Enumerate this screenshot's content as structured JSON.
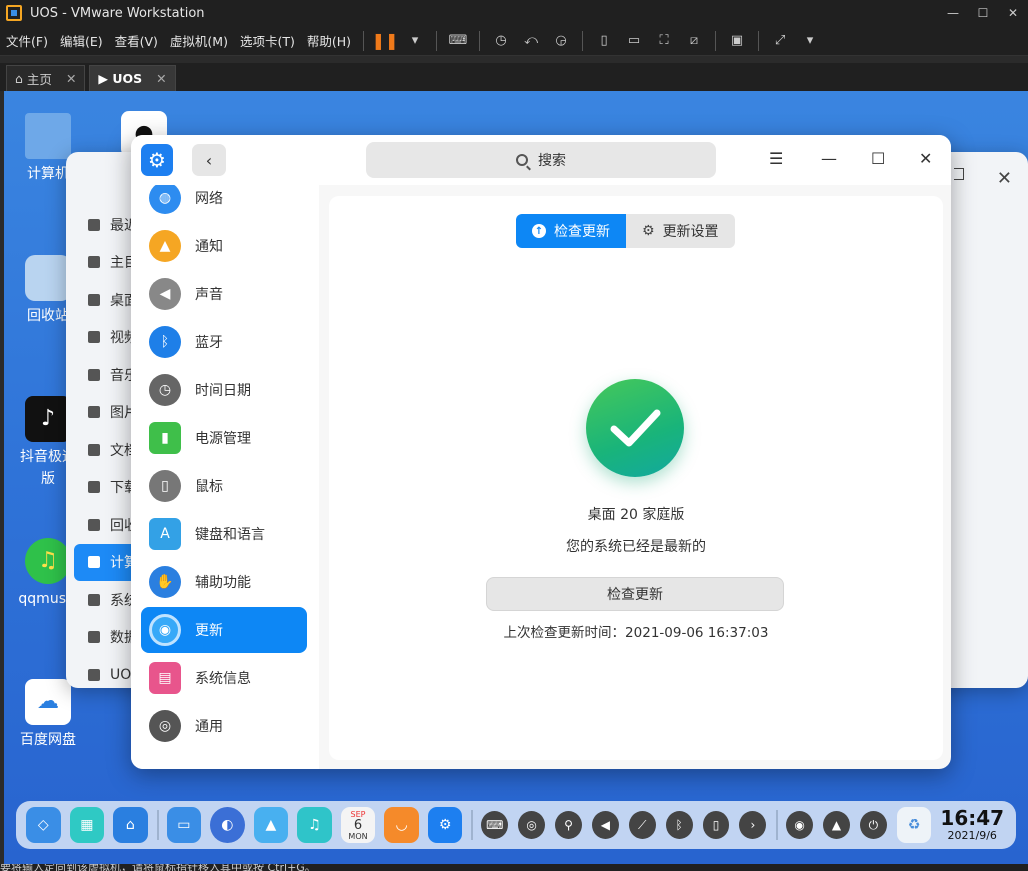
{
  "window": {
    "title": "UOS - VMware Workstation",
    "controls": [
      "—",
      "☐",
      "✕"
    ]
  },
  "menu": [
    "文件(F)",
    "编辑(E)",
    "查看(V)",
    "虚拟机(M)",
    "选项卡(T)",
    "帮助(H)"
  ],
  "tabs": [
    {
      "label": "主页",
      "close": "✕"
    },
    {
      "label": "UOS",
      "close": "✕"
    }
  ],
  "desktop_icons": [
    {
      "label": "计算机",
      "color": "#6ea8e8"
    },
    {
      "label": "回收站",
      "color": "#b9d4f0"
    },
    {
      "label": "抖音极速版",
      "color": "#111111"
    },
    {
      "label": "qqmusic",
      "color": "#2fc14a"
    },
    {
      "label": "百度网盘",
      "color": "#ffffff"
    }
  ],
  "file_manager": {
    "sidebar": [
      "最近",
      "主目",
      "桌面",
      "视频",
      "音乐",
      "图片",
      "文档",
      "下载",
      "回收",
      "计算",
      "系统",
      "数据",
      "UOS"
    ],
    "active_index": 9
  },
  "control_center": {
    "search_placeholder": "搜索",
    "back": "‹",
    "win_controls": [
      "☰",
      "—",
      "☐",
      "✕"
    ],
    "nav": [
      {
        "label": "网络",
        "color": "#2d8cf0"
      },
      {
        "label": "通知",
        "color": "#f5a623"
      },
      {
        "label": "声音",
        "color": "#888888"
      },
      {
        "label": "蓝牙",
        "color": "#1e7fe8"
      },
      {
        "label": "时间日期",
        "color": "#666666"
      },
      {
        "label": "电源管理",
        "color": "#3fbf4a"
      },
      {
        "label": "鼠标",
        "color": "#777777"
      },
      {
        "label": "键盘和语言",
        "color": "#33a1e6"
      },
      {
        "label": "辅助功能",
        "color": "#2a7fe0"
      },
      {
        "label": "更新",
        "color": "#37a9f8"
      },
      {
        "label": "系统信息",
        "color": "#e8558c"
      },
      {
        "label": "通用",
        "color": "#555555"
      }
    ],
    "active_nav": 9,
    "seg": {
      "check": "检查更新",
      "settings": "更新设置"
    },
    "edition": "桌面 20 家庭版",
    "status": "您的系统已经是最新的",
    "check_button": "检查更新",
    "last_check": "上次检查更新时间：2021-09-06 16:37:03"
  },
  "dock": {
    "apps": [
      "#3a8ee6",
      "#2fc9c4",
      "#2a7fe0",
      "#3a8ee6",
      "#3b6fd6",
      "#48b0f0",
      "#2fc4c9",
      "#f4f4f4",
      "#f58a2a",
      "#1d7ff0"
    ],
    "calendar": {
      "month": "SEP",
      "day": "6",
      "weekday": "MON"
    },
    "clock_time": "16:47",
    "clock_date": "2021/9/6"
  },
  "statusbar": "要将输入定向到该虚拟机，请将鼠标指针移入其中或按 Ctrl+G。"
}
